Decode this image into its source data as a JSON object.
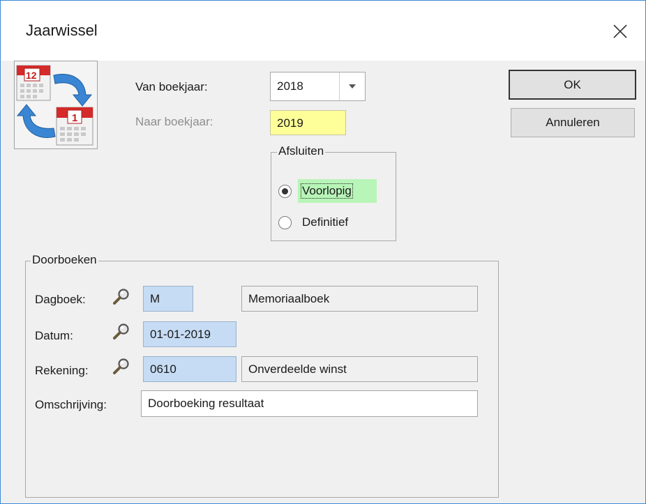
{
  "window": {
    "title": "Jaarwissel",
    "close_glyph": "✕"
  },
  "year": {
    "from_label": "Van boekjaar:",
    "from_value": "2018",
    "to_label": "Naar boekjaar:",
    "to_value": "2019"
  },
  "afsluiten": {
    "legend": "Afsluiten",
    "options": [
      {
        "label": "Voorlopig",
        "selected": true
      },
      {
        "label": "Definitief",
        "selected": false
      }
    ]
  },
  "buttons": {
    "ok": "OK",
    "cancel": "Annuleren"
  },
  "doorboeken": {
    "legend": "Doorboeken",
    "dagboek": {
      "label": "Dagboek:",
      "code": "M",
      "name": "Memoriaalboek"
    },
    "datum": {
      "label": "Datum:",
      "value": "01-01-2019"
    },
    "rekening": {
      "label": "Rekening:",
      "code": "0610",
      "name": "Onverdeelde winst"
    },
    "omschrijving": {
      "label": "Omschrijving:",
      "value": "Doorboeking resultaat"
    }
  },
  "colors": {
    "yellow_field": "#ffff99",
    "blue_field": "#c6dcf4",
    "selected_highlight": "#b8f5b8",
    "window_border": "#3c8ad8"
  },
  "icons": {
    "app": "calendar-cycle-icon",
    "lookup": "magnifier-icon",
    "dropdown": "chevron-down-icon"
  }
}
